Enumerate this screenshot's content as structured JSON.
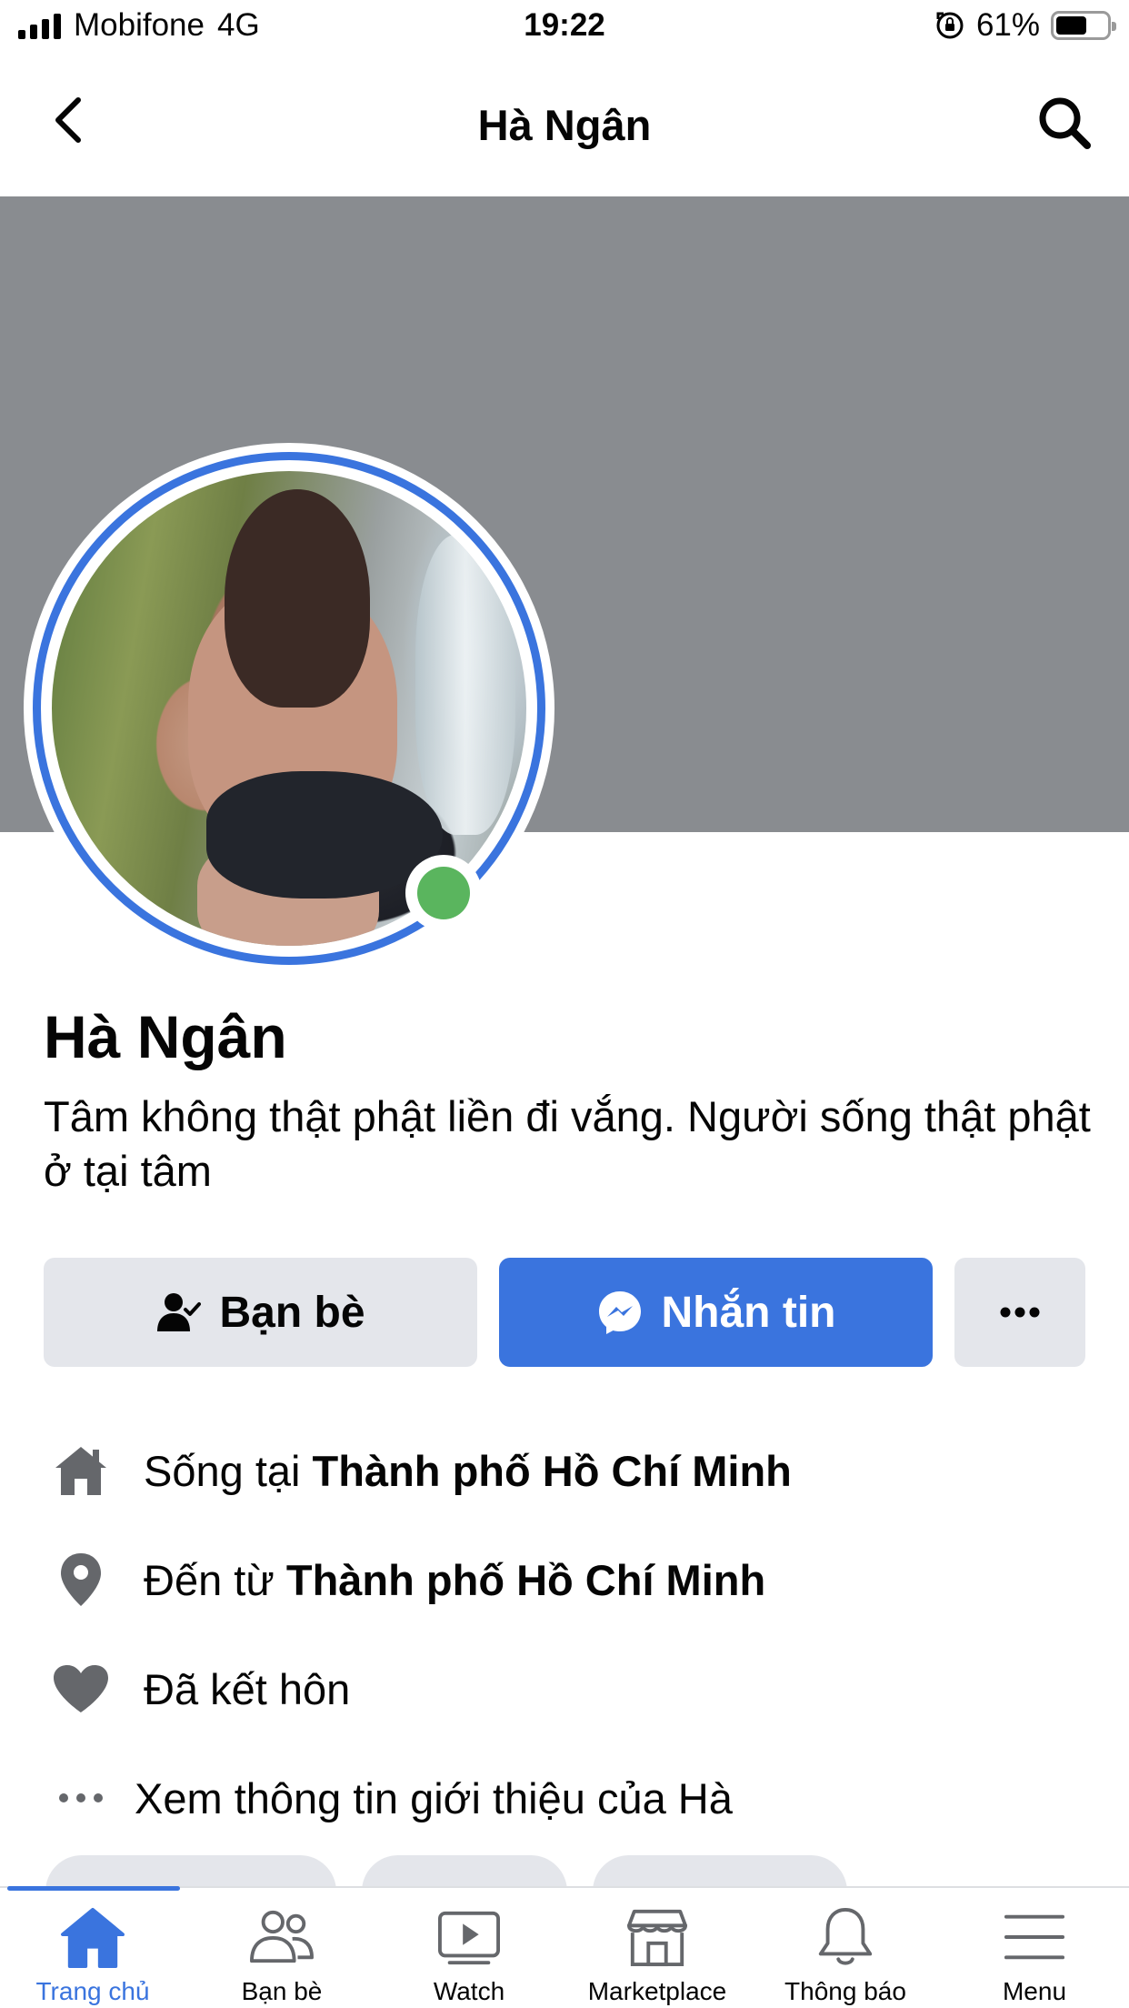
{
  "status_bar": {
    "carrier": "Mobifone",
    "network": "4G",
    "time": "19:22",
    "battery_percent": "61%",
    "battery_level": 0.61
  },
  "header": {
    "title": "Hà Ngân",
    "back_icon": "chevron-left-icon",
    "search_icon": "search-icon"
  },
  "profile": {
    "name": "Hà Ngân",
    "bio": "Tâm không thật phật liền đi vắng. Người sống thật phật ở tại tâm",
    "online": true
  },
  "actions": {
    "friends_label": "Bạn bè",
    "message_label": "Nhắn tin",
    "more_label": "..."
  },
  "about": {
    "lives_prefix": "Sống tại ",
    "lives_city": "Thành phố Hồ Chí Minh",
    "from_prefix": "Đến từ ",
    "from_city": "Thành phố Hồ Chí Minh",
    "relationship": "Đã kết hôn",
    "see_more": "Xem thông tin giới thiệu của Hà"
  },
  "tabs": [
    {
      "label": "Trang chủ",
      "icon": "home-icon",
      "active": true
    },
    {
      "label": "Bạn bè",
      "icon": "friends-icon",
      "active": false
    },
    {
      "label": "Watch",
      "icon": "watch-icon",
      "active": false
    },
    {
      "label": "Marketplace",
      "icon": "marketplace-icon",
      "active": false
    },
    {
      "label": "Thông báo",
      "icon": "bell-icon",
      "active": false
    },
    {
      "label": "Menu",
      "icon": "menu-icon",
      "active": false
    }
  ],
  "colors": {
    "accent": "#3a74de",
    "cover": "#898c90",
    "online": "#5ab55e",
    "button_gray": "#e4e6eb"
  }
}
